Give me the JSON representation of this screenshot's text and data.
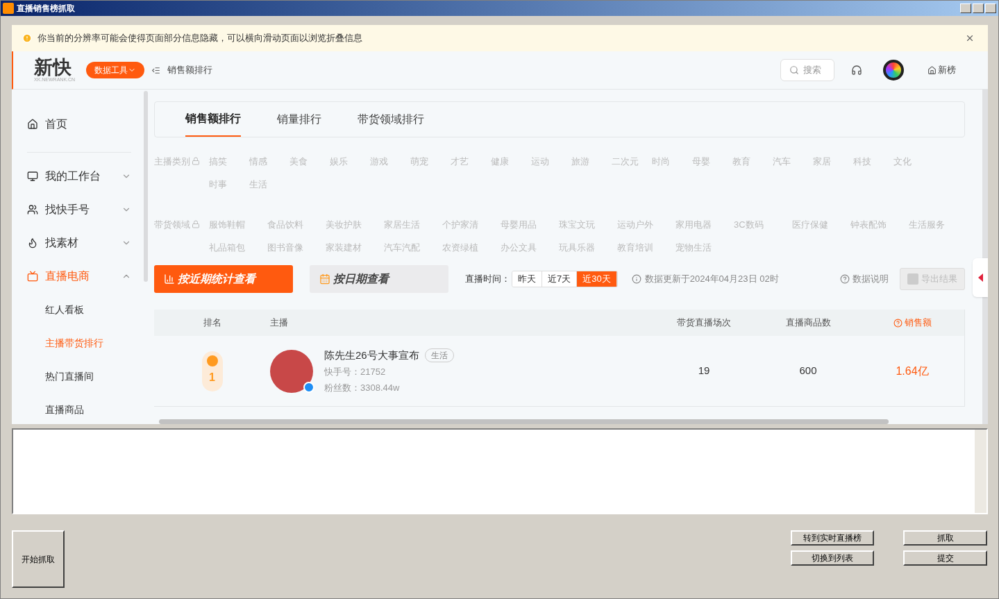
{
  "window": {
    "title": "直播销售榜抓取"
  },
  "notice": {
    "text": "你当前的分辨率可能会使得页面部分信息隐藏，可以横向滑动页面以浏览折叠信息"
  },
  "header": {
    "logo": "新快",
    "logo_sub": "XK.NEWRANK.CN",
    "tools_button": "数据工具",
    "breadcrumb": "销售额排行",
    "search_placeholder": "搜索",
    "new_list": "新榜"
  },
  "sidebar": [
    {
      "label": "首页",
      "selected": false
    },
    {
      "label": "我的工作台",
      "selected": false,
      "expanded": false
    },
    {
      "label": "找快手号",
      "selected": false,
      "expanded": false
    },
    {
      "label": "找素材",
      "selected": false,
      "expanded": false
    },
    {
      "label": "直播电商",
      "selected": true,
      "expanded": true,
      "children": [
        {
          "label": "红人看板",
          "selected": false
        },
        {
          "label": "主播带货排行",
          "selected": true
        },
        {
          "label": "热门直播间",
          "selected": false
        },
        {
          "label": "直播商品",
          "selected": false
        }
      ]
    }
  ],
  "tabs": [
    {
      "label": "销售额排行",
      "selected": true
    },
    {
      "label": "销量排行",
      "selected": false
    },
    {
      "label": "带货领域排行",
      "selected": false
    }
  ],
  "filters": [
    {
      "kind": "narrow",
      "label": "主播类别",
      "locked": true,
      "options": [
        "搞笑",
        "情感",
        "美食",
        "娱乐",
        "游戏",
        "萌宠",
        "才艺",
        "健康",
        "运动",
        "旅游",
        "二次元",
        "时尚",
        "母婴",
        "教育",
        "汽车",
        "家居",
        "科技",
        "文化",
        "时事",
        "生活"
      ]
    },
    {
      "kind": "wide",
      "label": "带货领域",
      "locked": true,
      "options": [
        "服饰鞋帽",
        "食品饮料",
        "美妆护肤",
        "家居生活",
        "个护家清",
        "母婴用品",
        "珠宝文玩",
        "运动户外",
        "家用电器",
        "3C数码",
        "医疗保健",
        "钟表配饰",
        "生活服务",
        "礼品箱包",
        "图书音像",
        "家装建材",
        "汽车汽配",
        "农资绿植",
        "办公文具",
        "玩具乐器",
        "教育培训",
        "宠物生活"
      ]
    }
  ],
  "view_buttons": [
    {
      "label": "按近期统计查看",
      "selected": true
    },
    {
      "label": "按日期查看",
      "selected": false
    }
  ],
  "time_range": {
    "label": "直播时间：",
    "options": [
      {
        "label": "昨天",
        "selected": false
      },
      {
        "label": "近7天",
        "selected": false
      },
      {
        "label": "近30天",
        "selected": true
      }
    ]
  },
  "update_text": "数据更新于2024年04月23日 02时",
  "data_note": "数据说明",
  "export_button": {
    "label": "导出结果",
    "disabled": true
  },
  "table": {
    "columns": [
      {
        "label": "排名",
        "sorted": false
      },
      {
        "label": "主播",
        "sorted": false
      },
      {
        "label": "带货直播场次",
        "sorted": false
      },
      {
        "label": "直播商品数",
        "sorted": false
      },
      {
        "label": "销售额",
        "sorted": true
      }
    ],
    "rows": [
      {
        "rank": "1",
        "name": "陈先生26号大事宣布",
        "tag": "生活",
        "account": "快手号：21752",
        "fans": "粉丝数：3308.44w",
        "sessions": "19",
        "products": "600",
        "sales": "1.64亿"
      }
    ]
  },
  "buttons": {
    "start": "开始抓取",
    "realtime": "转到实时直播榜",
    "fetch": "抓取",
    "switch_list": "切换到列表",
    "submit": "提交"
  }
}
